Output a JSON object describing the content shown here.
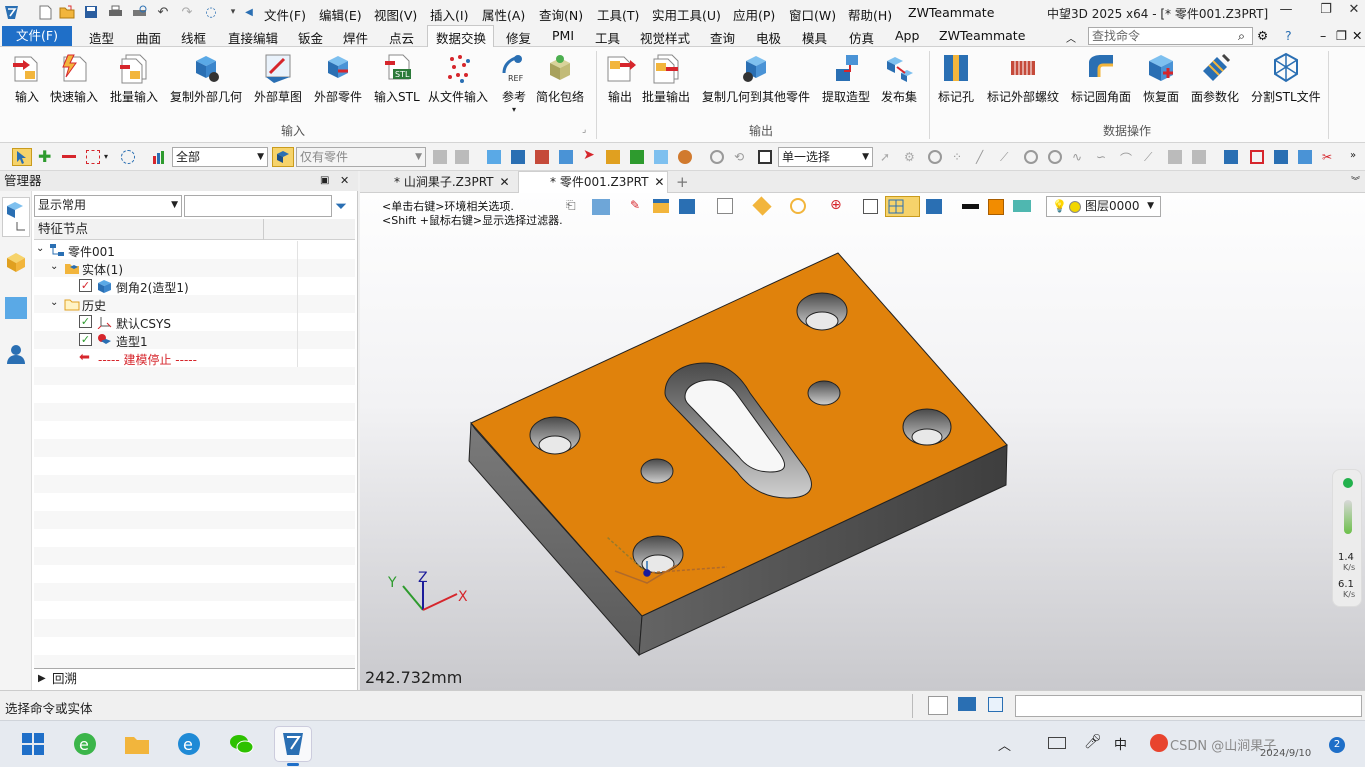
{
  "window": {
    "title": "中望3D 2025 x64 - [* 零件001.Z3PRT]",
    "menus": [
      "文件(F)",
      "编辑(E)",
      "视图(V)",
      "插入(I)",
      "属性(A)",
      "查询(N)",
      "工具(T)",
      "实用工具(U)",
      "应用(P)",
      "窗口(W)",
      "帮助(H)",
      "ZWTeammate"
    ]
  },
  "ribbon_tabs": [
    "文件(F)",
    "造型",
    "曲面",
    "线框",
    "直接编辑",
    "钣金",
    "焊件",
    "点云",
    "数据交换",
    "修复",
    "PMI",
    "工具",
    "视觉样式",
    "查询",
    "电极",
    "模具",
    "仿真",
    "App",
    "ZWTeammate"
  ],
  "search": {
    "placeholder": "查找命令"
  },
  "ribbon": {
    "import_buttons": [
      "输入",
      "快速输入",
      "批量输入",
      "复制外部几何",
      "外部草图",
      "外部零件",
      "输入STL",
      "从文件输入",
      "参考",
      "简化包络"
    ],
    "import_group": "输入",
    "export_buttons": [
      "输出",
      "批量输出",
      "复制几何到其他零件",
      "提取造型",
      "发布集"
    ],
    "export_group": "输出",
    "dataop_buttons": [
      "标记孔",
      "标记外部螺纹",
      "标记圆角面",
      "恢复面",
      "面参数化",
      "分割STL文件"
    ],
    "dataop_group": "数据操作",
    "stl_badge": "STL",
    "ref_badge": "REF"
  },
  "toolbar": {
    "filter_all": "全部",
    "filter_part": "仅有零件",
    "select_mode": "单一选择"
  },
  "manager": {
    "title": "管理器",
    "filter": "显示常用",
    "tree_header": "特征节点",
    "nodes": {
      "root": "零件001",
      "solid": "实体(1)",
      "chamfer": "倒角2(造型1)",
      "history": "历史",
      "csys": "默认CSYS",
      "shape": "造型1",
      "stop": "----- 建模停止 -----"
    },
    "rollback": "回溯"
  },
  "documents": {
    "tabs": [
      "* 山涧果子.Z3PRT",
      "* 零件001.Z3PRT"
    ],
    "active": 1
  },
  "viewport": {
    "hint1": "<单击右键>环境相关选项.",
    "hint2": "<Shift +鼠标右键>显示选择过滤器.",
    "layer": "图层0000",
    "measure": "242.732mm",
    "axis_x": "X",
    "axis_y": "Y",
    "axis_z": "Z",
    "net_up": "1.4",
    "net_up_unit": "K/s",
    "net_down": "6.1",
    "net_down_unit": "K/s",
    "part_top_color": "#e0820c"
  },
  "status": {
    "message": "选择命令或实体"
  },
  "taskbar": {
    "date": "2024/9/10",
    "watermark": "CSDN @山涧果子",
    "badge": "2",
    "ime": "中"
  }
}
